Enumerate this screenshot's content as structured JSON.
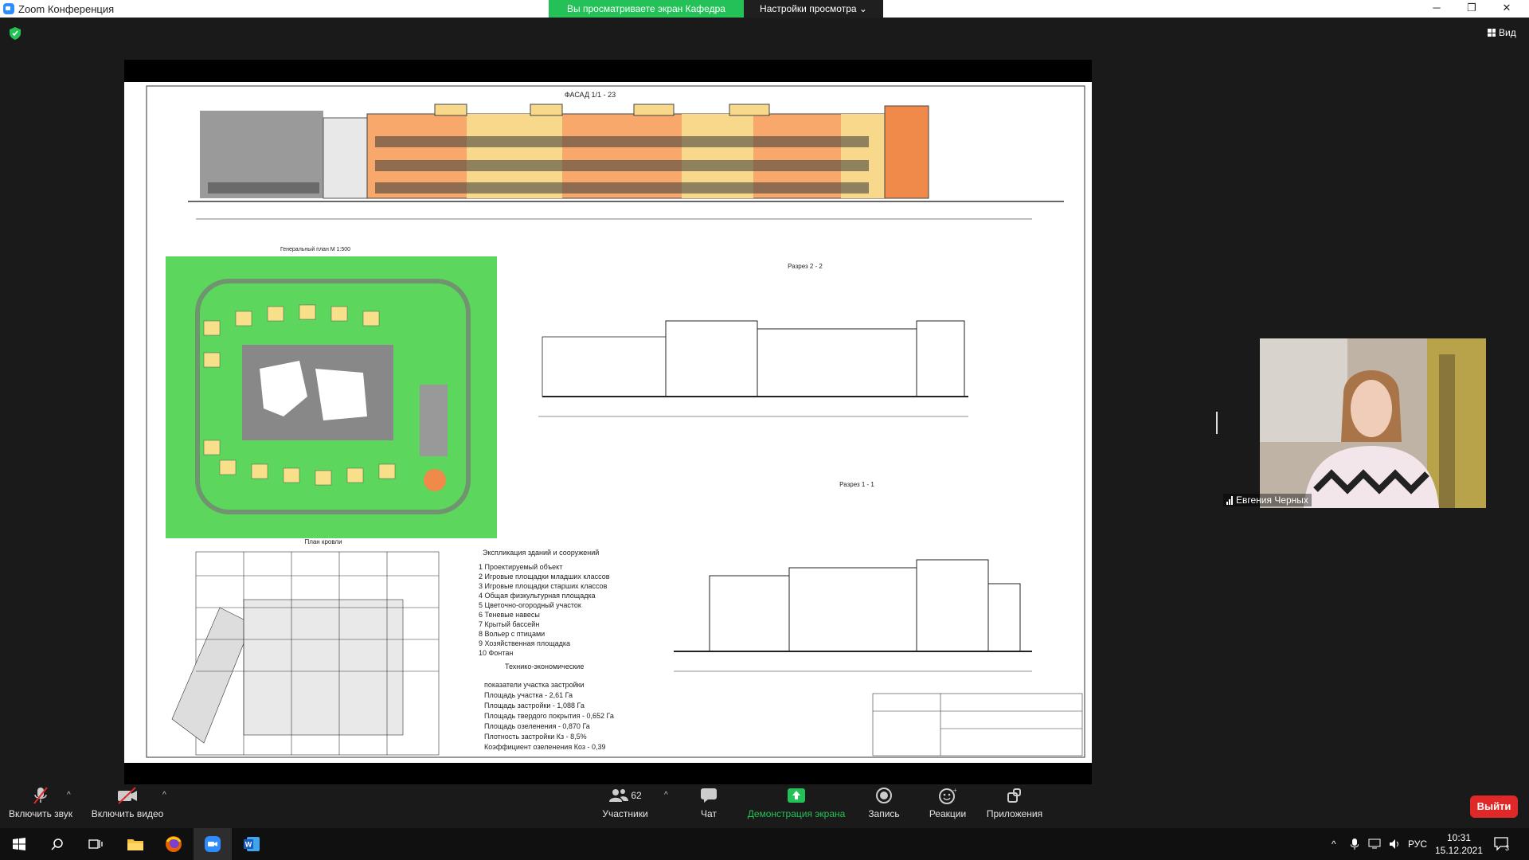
{
  "window": {
    "title": "Zoom Конференция",
    "share_banner": "Вы просматриваете экран Кафедра СиГХ",
    "view_settings": "Настройки просмотра",
    "view_button": "Вид",
    "minimize_icon": "minimize-icon",
    "restore_icon": "restore-icon",
    "close_icon": "close-icon"
  },
  "slide": {
    "facade_title": "ФАСАД 1/1 - 23",
    "genplan_title": "Генеральный план М 1:500",
    "section22_title": "Разрез 2 - 2",
    "section11_title": "Разрез 1 - 1",
    "roof_title": "План кровли",
    "explication_title": "Экспликация зданий и сооружений",
    "explication_items": [
      "1 Проектируемый объект",
      "2 Игровые площадки младших классов",
      "3 Игровые площадки старших классов",
      "4 Общая физкультурная площадка",
      "5 Цветочно-огородный участок",
      "6 Теневые навесы",
      "7 Крытый бассейн",
      "8 Вольер с птицами",
      "9 Хозяйственная площадка",
      "10 Фонтан"
    ],
    "tech_title": "Технико-экономические",
    "tech_items": [
      "показатели участка застройки",
      "Площадь участка - 2,61 Га",
      "Площадь застройки - 1,088 Га",
      "Площадь твердого покрытия - 0,652 Га",
      "Площадь озеленения - 0,870 Га",
      "Плотность застройки Кз - 8,5%",
      "Коэффициент озеленения Коз - 0,39"
    ]
  },
  "participant": {
    "name": "Евгения Черных"
  },
  "toolbar": {
    "mute_label": "Включить звук",
    "video_label": "Включить видео",
    "participants_label": "Участники",
    "participants_count": "62",
    "chat_label": "Чат",
    "share_label": "Демонстрация экрана",
    "record_label": "Запись",
    "reactions_label": "Реакции",
    "apps_label": "Приложения",
    "leave_label": "Выйти"
  },
  "taskbar": {
    "language": "РУС",
    "time": "10:31",
    "date": "15.12.2021",
    "notifications": "3"
  },
  "colors": {
    "zoom_blue": "#2d8cff",
    "share_green": "#23c157",
    "leave_red": "#e02828",
    "plan_green": "#5cd65c"
  }
}
